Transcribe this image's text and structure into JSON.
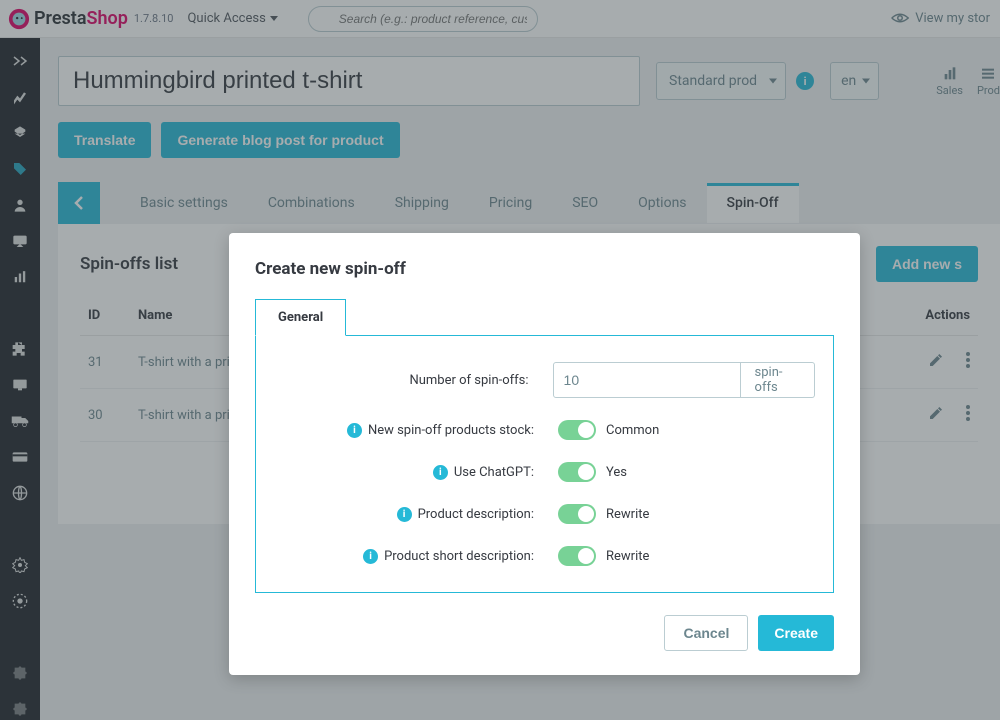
{
  "top": {
    "brand1": "Presta",
    "brand2": "Shop",
    "version": "1.7.8.10",
    "quick_access": "Quick Access",
    "search_placeholder": "Search (e.g.: product reference, custom",
    "view_store": "View my stor"
  },
  "page": {
    "title_value": "Hummingbird printed t-shirt",
    "type_select": "Standard prod",
    "lang_select": "en",
    "stat1": "Sales",
    "stat2": "Prod"
  },
  "buttons": {
    "translate": "Translate",
    "gen_blog": "Generate blog post for product",
    "add_new": "Add new s"
  },
  "tabs": [
    "Basic settings",
    "Combinations",
    "Shipping",
    "Pricing",
    "SEO",
    "Options",
    "Spin-Off"
  ],
  "panel": {
    "title": "Spin-offs list",
    "cols": {
      "id": "ID",
      "name": "Name",
      "actions": "Actions"
    },
    "rows": [
      {
        "id": "31",
        "name": "T-shirt with a print o"
      },
      {
        "id": "30",
        "name": "T-shirt with a print o"
      }
    ]
  },
  "modal": {
    "title": "Create new spin-off",
    "tab": "General",
    "field_number": "Number of spin-offs:",
    "number_value": "10",
    "number_addon": "spin-offs",
    "field_stock": "New spin-off products stock:",
    "stock_val": "Common",
    "field_gpt": "Use ChatGPT:",
    "gpt_val": "Yes",
    "field_desc": "Product description:",
    "desc_val": "Rewrite",
    "field_short": "Product short description:",
    "short_val": "Rewrite",
    "cancel": "Cancel",
    "create": "Create"
  }
}
